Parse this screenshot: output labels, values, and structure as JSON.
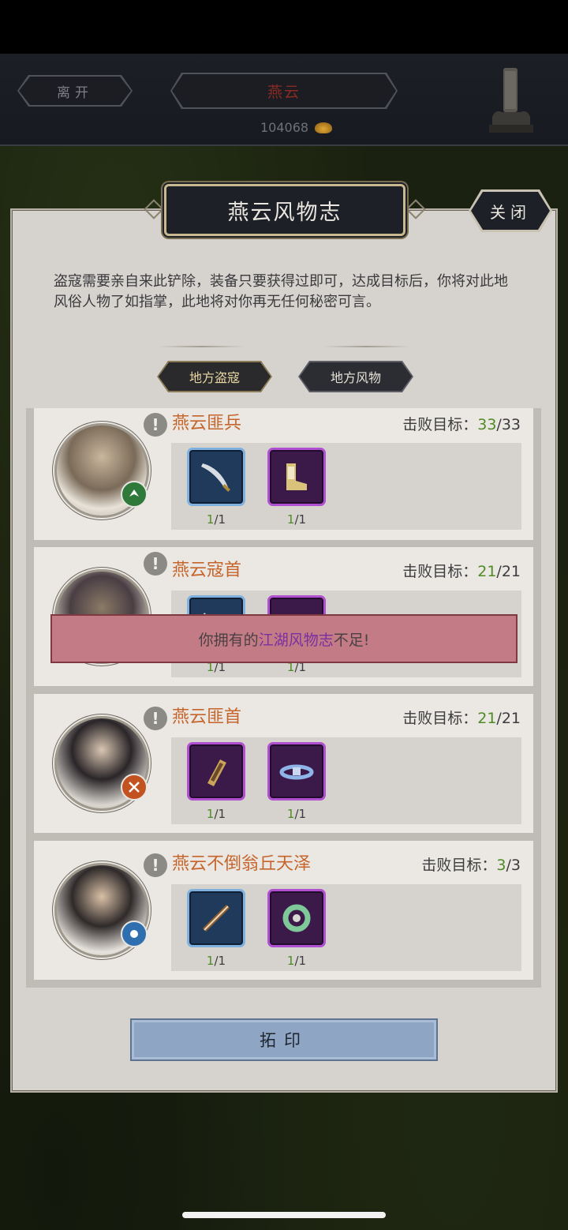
{
  "header": {
    "leave_label": "离开",
    "location_title": "燕云",
    "currency_value": "104068"
  },
  "dialog": {
    "title": "燕云风物志",
    "close_label": "关闭",
    "description": "盗寇需要亲自来此铲除，装备只要获得过即可，达成目标后，你将对此地风俗人物了如指掌，此地将对你再无任何秘密可言。",
    "tabs": [
      {
        "label": "地方盗寇",
        "active": true
      },
      {
        "label": "地方风物",
        "active": false
      }
    ],
    "enemies": [
      {
        "name": "燕云匪兵",
        "defeat_label": "击败目标：",
        "defeat_current": "33",
        "defeat_total": "/33",
        "badge_color": "#2f7a3a",
        "items": [
          {
            "rarity": "blue",
            "icon": "saber-icon",
            "count_current": "1",
            "count_total": "/1"
          },
          {
            "rarity": "purple",
            "icon": "boots-icon",
            "count_current": "1",
            "count_total": "/1"
          }
        ]
      },
      {
        "name": "燕云寇首",
        "defeat_label": "击败目标：",
        "defeat_current": "21",
        "defeat_total": "/21",
        "badge_color": "#7a4aa0",
        "items": [
          {
            "rarity": "blue",
            "icon": "blade-icon",
            "count_current": "1",
            "count_total": "/1"
          },
          {
            "rarity": "purple",
            "icon": "helmet-icon",
            "count_current": "1",
            "count_total": "/1"
          }
        ]
      },
      {
        "name": "燕云匪首",
        "defeat_label": "击败目标：",
        "defeat_current": "21",
        "defeat_total": "/21",
        "badge_color": "#c2521f",
        "items": [
          {
            "rarity": "purple",
            "icon": "bracer-icon",
            "count_current": "1",
            "count_total": "/1"
          },
          {
            "rarity": "purple",
            "icon": "belt-icon",
            "count_current": "1",
            "count_total": "/1"
          }
        ]
      },
      {
        "name": "燕云不倒翁丘天泽",
        "defeat_label": "击败目标：",
        "defeat_current": "3",
        "defeat_total": "/3",
        "badge_color": "#2f6fb0",
        "items": [
          {
            "rarity": "blue",
            "icon": "staff-icon",
            "count_current": "1",
            "count_total": "/1"
          },
          {
            "rarity": "purple",
            "icon": "jade-pendant-icon",
            "count_current": "1",
            "count_total": "/1"
          }
        ]
      }
    ],
    "action_label": "拓印"
  },
  "toast": {
    "prefix": "你拥有的",
    "highlight": "江湖风物志",
    "suffix": "不足!"
  }
}
